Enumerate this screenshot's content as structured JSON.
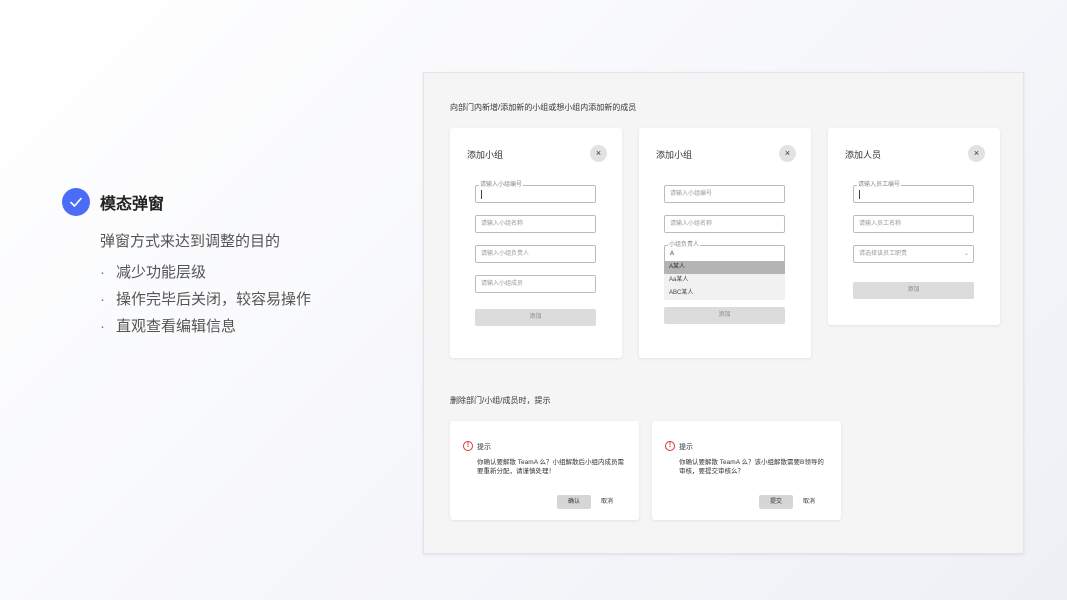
{
  "left": {
    "heading": "模态弹窗",
    "description": "弹窗方式来达到调整的目的",
    "bullets": [
      "减少功能层级",
      "操作完毕后关闭，较容易操作",
      "直观查看编辑信息"
    ],
    "bullet_symbol": "·",
    "accent_color": "#4a6cf7"
  },
  "panel": {
    "section1_title": "向部门内新增/添加新的小组或想小组内添加新的成员",
    "section2_title": "删除部门/小组/成员时，提示",
    "close_symbol": "×",
    "card1": {
      "title": "添加小组",
      "field1_label": "请输入小组编号",
      "field2_placeholder": "请输入小组名称",
      "field3_placeholder": "请输入小组负责人",
      "field4_placeholder": "请输入小组成员",
      "submit_label": "添加"
    },
    "card2": {
      "title": "添加小组",
      "field1_placeholder": "请输入小组编号",
      "field2_placeholder": "请输入小组名称",
      "field3_label": "小组负责人",
      "field3_value": "A",
      "options": [
        "A某人",
        "Aa某人",
        "ABC某人"
      ],
      "submit_label": "添加"
    },
    "card3": {
      "title": "添加人员",
      "field1_label": "请输入员工编号",
      "field2_placeholder": "请输入员工名称",
      "field3_placeholder": "请选择该员工职责",
      "submit_label": "添加"
    },
    "tip1": {
      "icon_symbol": "!",
      "title": "提示",
      "body": "你确认要解散 TeamA 么？小组解散后小组内成员需要重新分配，请谨慎处理！",
      "confirm_label": "确认",
      "cancel_label": "取消"
    },
    "tip2": {
      "icon_symbol": "!",
      "title": "提示",
      "body": "你确认要解散 TeamA 么？该小组解散需要B领导的审核，要提交审核么？",
      "confirm_label": "提交",
      "cancel_label": "取消"
    }
  }
}
